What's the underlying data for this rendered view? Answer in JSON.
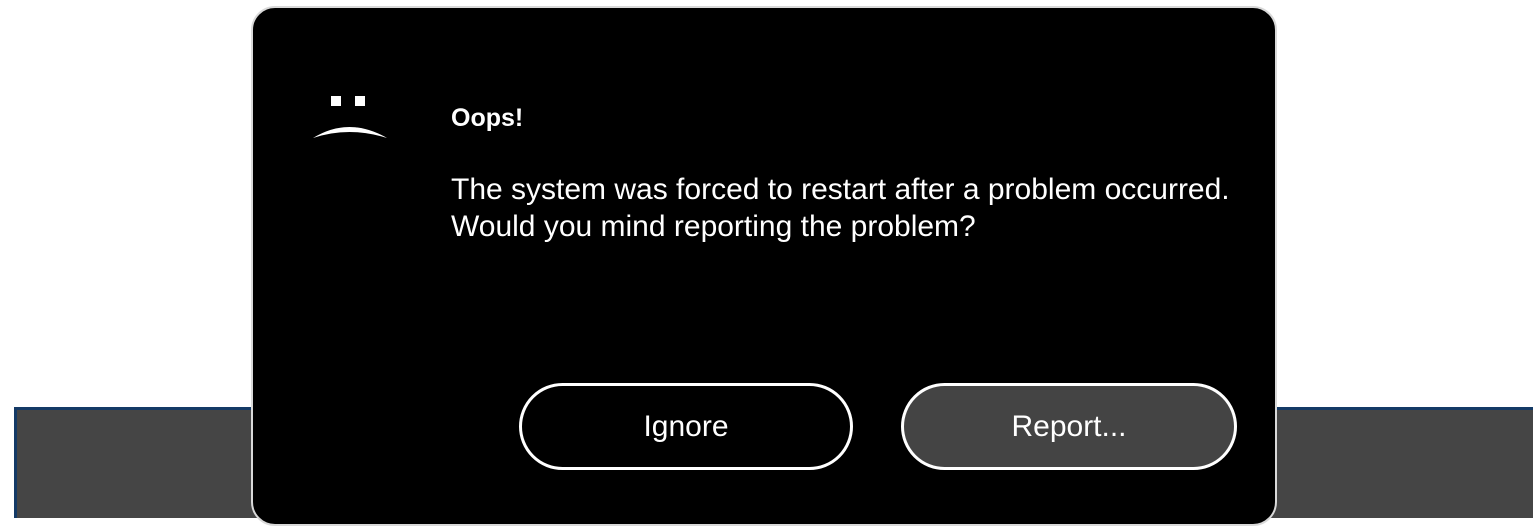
{
  "dialog": {
    "icon": "sad-face-icon",
    "title": "Oops!",
    "message": "The system was forced to restart after a problem occurred. Would you mind reporting the problem?",
    "buttons": {
      "ignore_label": "Ignore",
      "report_label": "Report..."
    }
  },
  "colors": {
    "dialog_background": "#000000",
    "dialog_border": "#d9d9d9",
    "text": "#ffffff",
    "report_button_fill": "#444444",
    "backdrop_panel": "#454545",
    "backdrop_border": "#143a66"
  }
}
